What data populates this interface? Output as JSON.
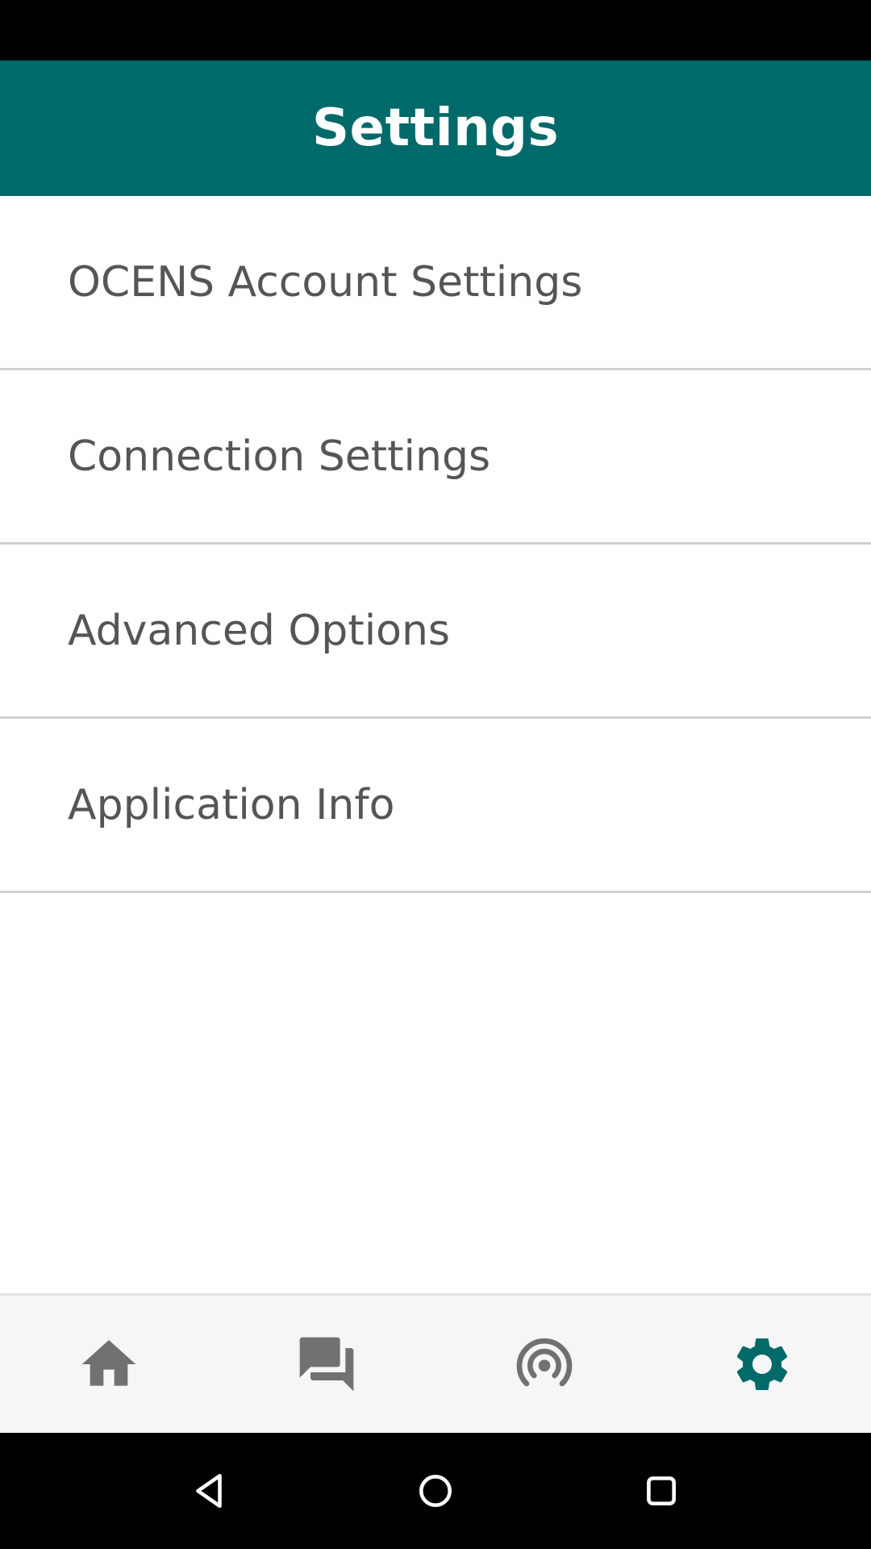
{
  "app_bar": {
    "title": "Settings"
  },
  "settings_items": [
    {
      "label": "OCENS Account Settings"
    },
    {
      "label": "Connection Settings"
    },
    {
      "label": "Advanced Options"
    },
    {
      "label": "Application Info"
    }
  ],
  "bottom_nav": {
    "items": [
      {
        "icon": "home-icon",
        "active": false
      },
      {
        "icon": "chat-icon",
        "active": false
      },
      {
        "icon": "signal-icon",
        "active": false
      },
      {
        "icon": "gear-icon",
        "active": true
      }
    ]
  },
  "colors": {
    "primary": "#00696a",
    "text": "#555555",
    "inactive_icon": "#717171",
    "divider": "#d0d0d0",
    "nav_background": "#f6f6f6"
  },
  "system_nav": {
    "icons": [
      "back-icon",
      "home-circle-icon",
      "recents-icon"
    ]
  }
}
